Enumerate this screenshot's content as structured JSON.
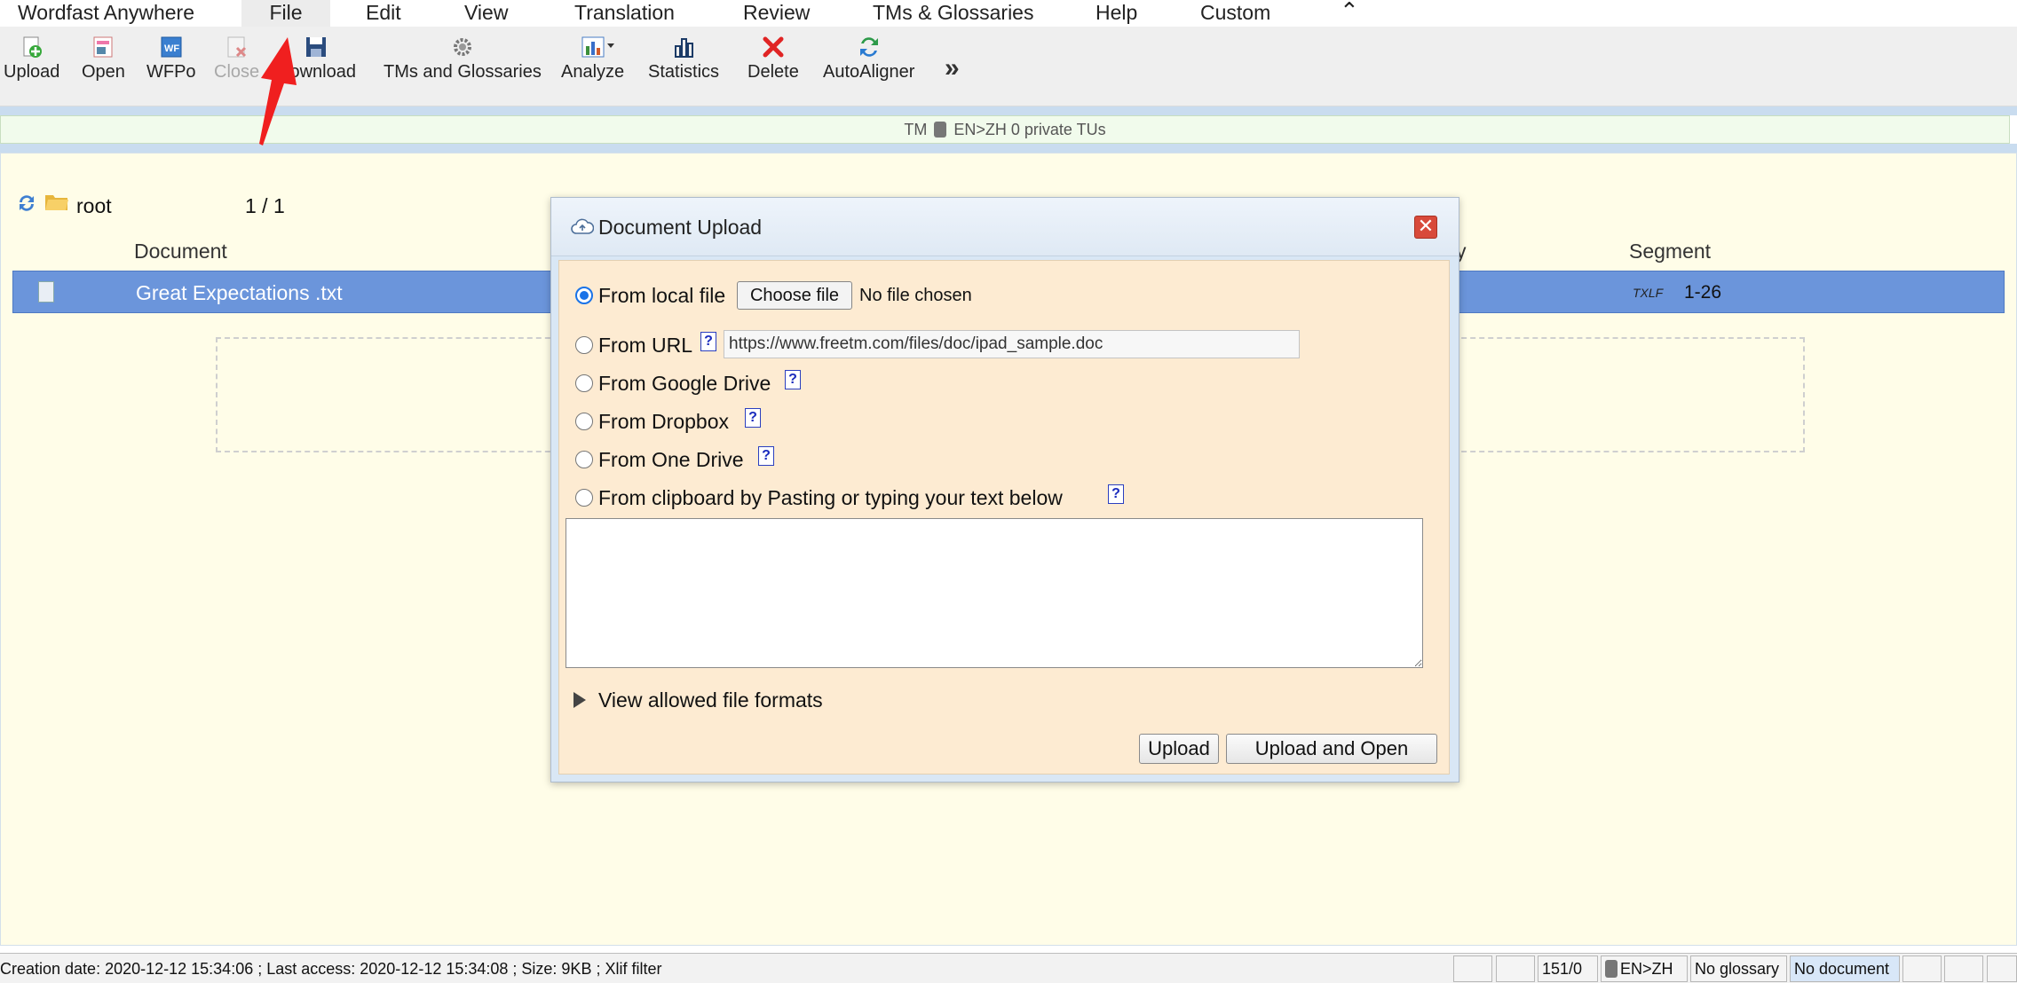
{
  "menubar": {
    "items": [
      "Wordfast Anywhere",
      "File",
      "Edit",
      "View",
      "Translation",
      "Review",
      "TMs & Glossaries",
      "Help",
      "Custom"
    ],
    "collapse_icon": "double-chevron-up-icon"
  },
  "toolbar": {
    "upload": "Upload",
    "open": "Open",
    "wfpo": "WFPo",
    "close": "Close",
    "download": "Download",
    "tms": "TMs and Glossaries",
    "analyze": "Analyze",
    "statistics": "Statistics",
    "delete": "Delete",
    "autoaligner": "AutoAligner",
    "more": "»"
  },
  "tm_bar": {
    "prefix": "TM",
    "text": "EN>ZH 0 private TUs"
  },
  "folder": {
    "name": "root",
    "page": "1 / 1"
  },
  "table": {
    "col_document": "Document",
    "col_y": "y",
    "col_segment": "Segment",
    "row": {
      "name": "Great Expectations .txt",
      "format": "TXLF",
      "segment": "1-26"
    }
  },
  "dialog": {
    "title": "Document Upload",
    "close": "✕",
    "opt_local": "From local file",
    "choose_file": "Choose file",
    "no_file": "No file chosen",
    "opt_url": "From URL",
    "url_value": "https://www.freetm.com/files/doc/ipad_sample.doc",
    "opt_gdrive": "From Google Drive",
    "opt_dropbox": "From Dropbox",
    "opt_onedrive": "From One Drive",
    "opt_clipboard": "From clipboard by Pasting or typing your text below",
    "help": "?",
    "formats": "View allowed file formats",
    "upload": "Upload",
    "upload_open": "Upload and Open"
  },
  "statusbar": {
    "info": "Creation date: 2020-12-12 15:34:06 ; Last access: 2020-12-12 15:34:08 ; Size: 9KB ; Xlif filter",
    "count": "151/0",
    "lang": "EN>ZH",
    "glossary": "No glossary",
    "document": "No document"
  },
  "colors": {
    "row_highlight": "#6b95db",
    "dialog_body": "#fdebd2",
    "arrow": "#f01f1f"
  }
}
